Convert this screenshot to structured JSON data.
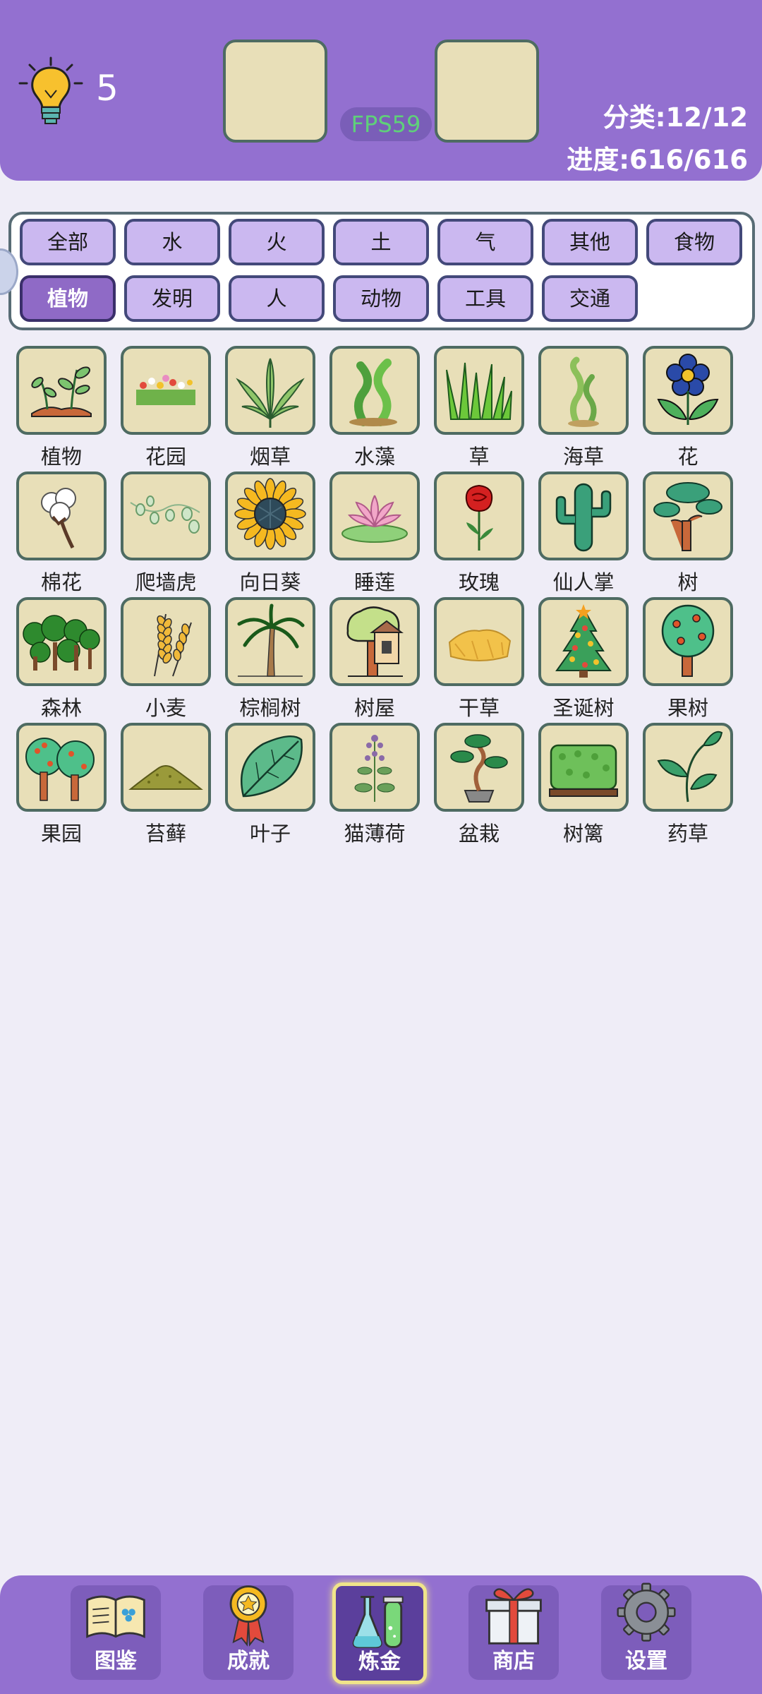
{
  "header": {
    "hint_count": "5",
    "fps": "FPS59",
    "category_stat": "分类:12/12",
    "progress_stat": "进度:616/616"
  },
  "filters": [
    {
      "label": "全部",
      "active": false
    },
    {
      "label": "水",
      "active": false
    },
    {
      "label": "火",
      "active": false
    },
    {
      "label": "土",
      "active": false
    },
    {
      "label": "气",
      "active": false
    },
    {
      "label": "其他",
      "active": false
    },
    {
      "label": "食物",
      "active": false
    },
    {
      "label": "植物",
      "active": true
    },
    {
      "label": "发明",
      "active": false
    },
    {
      "label": "人",
      "active": false
    },
    {
      "label": "动物",
      "active": false
    },
    {
      "label": "工具",
      "active": false
    },
    {
      "label": "交通",
      "active": false
    }
  ],
  "items": [
    {
      "label": "植物",
      "icon": "sprout-icon"
    },
    {
      "label": "花园",
      "icon": "garden-icon"
    },
    {
      "label": "烟草",
      "icon": "tobacco-leaf-icon"
    },
    {
      "label": "水藻",
      "icon": "algae-icon"
    },
    {
      "label": "草",
      "icon": "grass-icon"
    },
    {
      "label": "海草",
      "icon": "seaweed-icon"
    },
    {
      "label": "花",
      "icon": "flower-icon"
    },
    {
      "label": "棉花",
      "icon": "cotton-icon"
    },
    {
      "label": "爬墙虎",
      "icon": "ivy-icon"
    },
    {
      "label": "向日葵",
      "icon": "sunflower-icon"
    },
    {
      "label": "睡莲",
      "icon": "water-lily-icon"
    },
    {
      "label": "玫瑰",
      "icon": "rose-icon"
    },
    {
      "label": "仙人掌",
      "icon": "cactus-icon"
    },
    {
      "label": "树",
      "icon": "tree-icon"
    },
    {
      "label": "森林",
      "icon": "forest-icon"
    },
    {
      "label": "小麦",
      "icon": "wheat-icon"
    },
    {
      "label": "棕榈树",
      "icon": "palm-tree-icon"
    },
    {
      "label": "树屋",
      "icon": "treehouse-icon"
    },
    {
      "label": "干草",
      "icon": "hay-icon"
    },
    {
      "label": "圣诞树",
      "icon": "christmas-tree-icon"
    },
    {
      "label": "果树",
      "icon": "fruit-tree-icon"
    },
    {
      "label": "果园",
      "icon": "orchard-icon"
    },
    {
      "label": "苔藓",
      "icon": "moss-icon"
    },
    {
      "label": "叶子",
      "icon": "leaf-icon"
    },
    {
      "label": "猫薄荷",
      "icon": "catnip-icon"
    },
    {
      "label": "盆栽",
      "icon": "bonsai-icon"
    },
    {
      "label": "树篱",
      "icon": "hedge-icon"
    },
    {
      "label": "药草",
      "icon": "herb-icon"
    }
  ],
  "nav": [
    {
      "label": "图鉴",
      "icon": "encyclopedia-book-icon",
      "active": false
    },
    {
      "label": "成就",
      "icon": "achievement-medal-icon",
      "active": false
    },
    {
      "label": "炼金",
      "icon": "alchemy-flask-icon",
      "active": true
    },
    {
      "label": "商店",
      "icon": "gift-box-icon",
      "active": false
    },
    {
      "label": "设置",
      "icon": "gear-icon",
      "active": false
    }
  ],
  "colors": {
    "header_bg": "#9370d0",
    "page_bg": "#efedf7",
    "tile_bg": "#e8dfb8",
    "filter_bg": "#cbb8f0",
    "filter_active_bg": "#8f6ac6",
    "fps_text": "#5fd07a"
  }
}
